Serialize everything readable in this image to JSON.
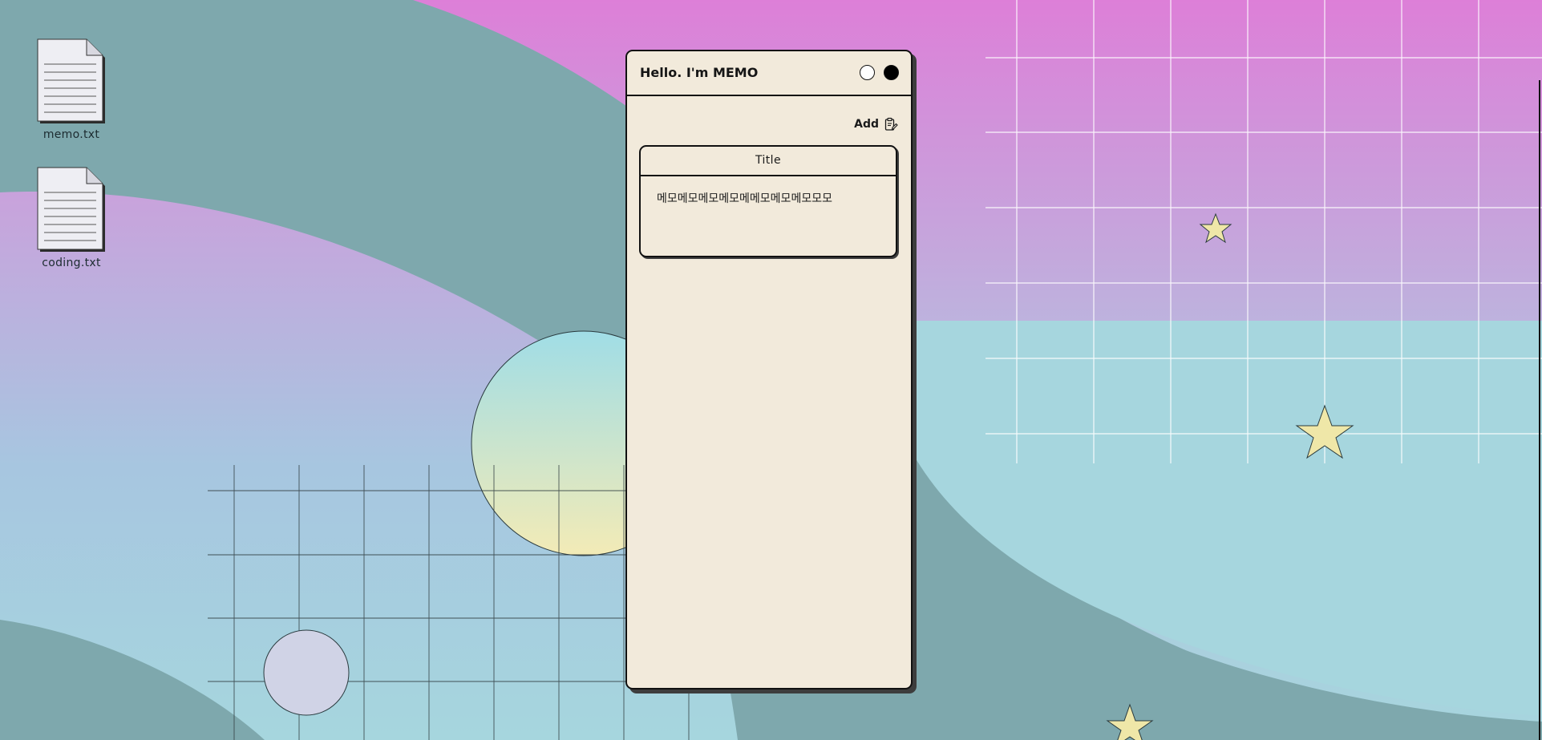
{
  "desktop": {
    "icons": [
      {
        "name": "memo.txt",
        "icon": "text-file-icon"
      },
      {
        "name": "coding.txt",
        "icon": "text-file-icon"
      }
    ],
    "colors": {
      "pink_top": "#dd7fd8",
      "teal_band": "#7ea8ad",
      "light_teal": "#a6d6de",
      "star_fill": "#efe7a8",
      "sun_top": "#a0dde6",
      "sun_bottom": "#f3ebb6",
      "small_moon": "#d0d3e6"
    }
  },
  "memo_window": {
    "title": "Hello. I'm MEMO",
    "minimize_icon": "circle-outline-icon",
    "close_icon": "circle-filled-icon",
    "add_label": "Add",
    "add_icon": "clipboard-edit-icon",
    "bg_color": "#f2eadb",
    "memos": [
      {
        "title": "Title",
        "content": "메모메모메모메모메메모메모메모모모"
      }
    ]
  }
}
